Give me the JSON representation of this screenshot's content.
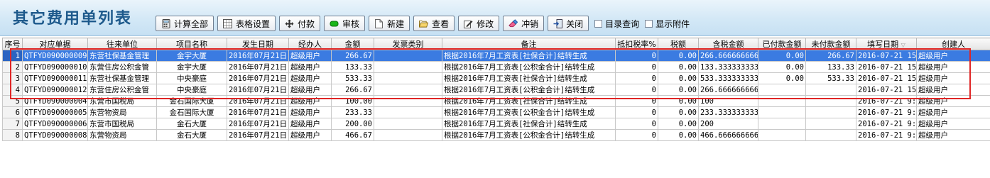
{
  "window": {
    "title": "其它费用单列表"
  },
  "toolbar": {
    "buttons": [
      {
        "label": "计算全部",
        "icon": "calculator-icon"
      },
      {
        "label": "表格设置",
        "icon": "table-grid-icon"
      },
      {
        "label": "付款",
        "icon": "move-arrows-icon"
      },
      {
        "label": "审核",
        "icon": "green-check-icon"
      },
      {
        "label": "新建",
        "icon": "new-document-icon"
      },
      {
        "label": "查看",
        "icon": "open-folder-icon"
      },
      {
        "label": "修改",
        "icon": "edit-icon"
      },
      {
        "label": "冲销",
        "icon": "eraser-icon"
      },
      {
        "label": "关闭",
        "icon": "exit-door-icon"
      }
    ],
    "checkboxes": [
      {
        "label": "目录查询",
        "checked": false
      },
      {
        "label": "显示附件",
        "checked": false
      }
    ]
  },
  "table": {
    "columns": [
      "序号",
      "对应单据",
      "往来单位",
      "项目名称",
      "发生日期",
      "经办人",
      "金额",
      "发票类别",
      "备注",
      "抵扣税率%",
      "税额",
      "含税金额",
      "已付款金额",
      "未付款金额",
      "填写日期",
      "创建人"
    ],
    "rows": [
      [
        "1",
        "QTFYD090000009",
        "东营社保基金管理",
        "金宇大厦",
        "2016年07月21日",
        "超级用户",
        "266.67",
        "",
        "根据2016年7月工资表[社保合计]结转生成",
        "0",
        "0.00",
        "266.666666666",
        "0.00",
        "266.67",
        "2016-07-21 15",
        "超级用户"
      ],
      [
        "2",
        "QTFYD090000010",
        "东营住房公积金管",
        "金宇大厦",
        "2016年07月21日",
        "超级用户",
        "133.33",
        "",
        "根据2016年7月工资表[公积金合计]结转生成",
        "0",
        "0.00",
        "133.333333333",
        "0.00",
        "133.33",
        "2016-07-21 15",
        "超级用户"
      ],
      [
        "3",
        "QTFYD090000011",
        "东营社保基金管理",
        "中央豪庭",
        "2016年07月21日",
        "超级用户",
        "533.33",
        "",
        "根据2016年7月工资表[社保合计]结转生成",
        "0",
        "0.00",
        "533.333333333",
        "0.00",
        "533.33",
        "2016-07-21 15",
        "超级用户"
      ],
      [
        "4",
        "QTFYD090000012",
        "东营住房公积金管",
        "中央豪庭",
        "2016年07月21日",
        "超级用户",
        "266.67",
        "",
        "根据2016年7月工资表[公积金合计]结转生成",
        "0",
        "0.00",
        "266.666666666",
        "",
        "",
        "2016-07-21 15",
        "超级用户"
      ],
      [
        "5",
        "QTFYD090000004",
        "东营市国税局",
        "金石国际大厦",
        "2016年07月21日",
        "超级用户",
        "100.00",
        "",
        "根据2016年7月工资表[社保合计]结转生成",
        "0",
        "0.00",
        "100",
        "",
        "",
        "2016-07-21 9:",
        "超级用户"
      ],
      [
        "6",
        "QTFYD090000005",
        "东营物资局",
        "金石国际大厦",
        "2016年07月21日",
        "超级用户",
        "233.33",
        "",
        "根据2016年7月工资表[公积金合计]结转生成",
        "0",
        "0.00",
        "233.333333333",
        "",
        "",
        "2016-07-21 9:",
        "超级用户"
      ],
      [
        "7",
        "QTFYD090000006",
        "东营市国税局",
        "金石大厦",
        "2016年07月21日",
        "超级用户",
        "200.00",
        "",
        "根据2016年7月工资表[社保合计]结转生成",
        "0",
        "0.00",
        "200",
        "",
        "",
        "2016-07-21 9:",
        "超级用户"
      ],
      [
        "8",
        "QTFYD090000008",
        "东营物资局",
        "金石大厦",
        "2016年07月21日",
        "超级用户",
        "466.67",
        "",
        "根据2016年7月工资表[公积金合计]结转生成",
        "0",
        "0.00",
        "466.666666666",
        "",
        "",
        "2016-07-21 9:",
        "超级用户"
      ]
    ],
    "selected_row": 1
  },
  "colors": {
    "title": "#1e5a8c",
    "selection": "#3b7be1",
    "highlight_box": "#e02626"
  }
}
